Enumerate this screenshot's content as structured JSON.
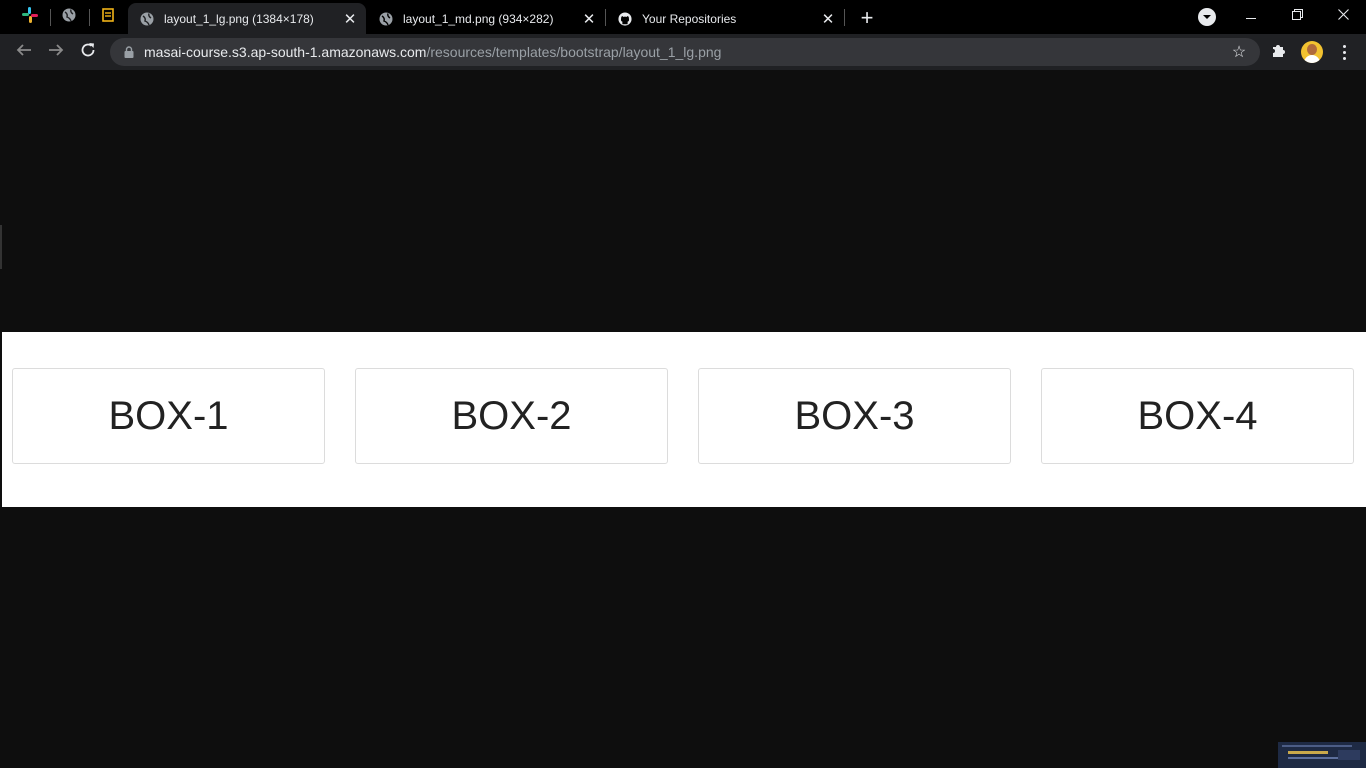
{
  "colors": {
    "tab_bg": "#000000",
    "active_tab": "#202124",
    "toolbar": "#202124",
    "omnibox": "#35363a",
    "page_bg": "#0e0e0e",
    "image_bg": "#ffffff"
  },
  "pinned_tabs": [
    {
      "icon": "slack-icon"
    },
    {
      "icon": "globe-icon"
    },
    {
      "icon": "document-icon"
    }
  ],
  "tabs": [
    {
      "title": "layout_1_lg.png (1384×178)",
      "icon": "globe-icon",
      "active": true
    },
    {
      "title": "layout_1_md.png (934×282)",
      "icon": "globe-icon",
      "active": false
    },
    {
      "title": "Your Repositories",
      "icon": "github-icon",
      "active": false
    }
  ],
  "omnibox": {
    "host": "masai-course.s3.ap-south-1.amazonaws.com",
    "path": "/resources/templates/bootstrap/layout_1_lg.png"
  },
  "image": {
    "boxes": [
      "BOX-1",
      "BOX-2",
      "BOX-3",
      "BOX-4"
    ]
  }
}
